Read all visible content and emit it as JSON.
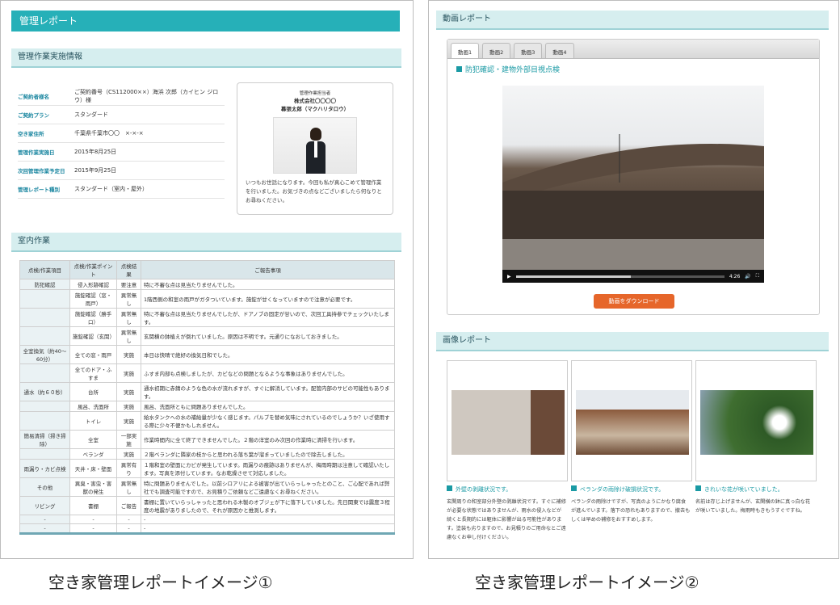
{
  "left": {
    "title": "管理レポート",
    "sec1": "管理作業実施情報",
    "info": [
      {
        "k": "ご契約者様名",
        "v": "ご契約番号（CS112000××）海浜 次郎（カイヒン ジロウ）様"
      },
      {
        "k": "ご契約プラン",
        "v": "スタンダード"
      },
      {
        "k": "空き家住所",
        "v": "千葉県千葉市〇〇　×-×-×"
      },
      {
        "k": "管理作業実施日",
        "v": "2015年8月25日"
      },
      {
        "k": "次回管理作業予定日",
        "v": "2015年9月25日"
      },
      {
        "k": "管理レポート種別",
        "v": "スタンダード（室内・屋外）"
      }
    ],
    "mgr_role": "管理作業担当者",
    "mgr_company": "株式会社〇〇〇〇",
    "mgr_name": "幕張太郎（マクハリタロウ）",
    "mgr_msg": "いつもお世話になります。今回も私が真心こめて管理作業を行いました。お気づきの点などございましたら何なりとお尋ねください。",
    "sec2": "室内作業",
    "table_head": [
      "点検/作業項目",
      "点検/作業ポイント",
      "点検結果",
      "ご報告事項"
    ],
    "rows": [
      [
        "防犯確認",
        "侵入形跡確認",
        "要注意",
        "特に不審な点は見当たりませんでした。"
      ],
      [
        "",
        "施錠確認（窓・雨戸）",
        "異常無し",
        "1階西側の和室の雨戸がガタついています。施錠が甘くなっていますので注意が必要です。"
      ],
      [
        "",
        "施錠確認（勝手口）",
        "異常無し",
        "特に不審な点は見当たりませんでしたが、ドアノブの固定が甘いので、次回工具持参でチェックいたします。"
      ],
      [
        "",
        "施錠確認（玄関）",
        "異常無し",
        "玄関横の鉢植えが倒れていました。原因は不明です。元通りになおしておきました。"
      ],
      [
        "全室換気（約40〜60分）",
        "全ての窓・雨戸",
        "実施",
        "本日は快晴で絶好の換気日和でした。"
      ],
      [
        "",
        "全てのドア・ふすま",
        "実施",
        "ふすま内部も点検しましたが、カビなどの問題となるような事象はありませんでした。"
      ],
      [
        "通水（約６０秒）",
        "台所",
        "実施",
        "通水初期に赤錆のような色の水が流れますが、すぐに解消しています。配管内部のサビの可能性もあります。"
      ],
      [
        "",
        "風呂、洗面所",
        "実施",
        "風呂、洗面所ともに問題ありませんでした。"
      ],
      [
        "",
        "トイレ",
        "実施",
        "給水タンクへの水の補給量が少なく感じます。パルブを替め気味にされているのでしょうか？いざ使用する際に少々不便かもしれません。"
      ],
      [
        "簡易清掃（掃き掃除）",
        "全室",
        "一部実施",
        "作業時間内に全て終了できませんでした。２階の洋室のみ次回の作業時に清掃を行います。"
      ],
      [
        "",
        "ベランダ",
        "実施",
        "２階ベランダに隣家の枝からと思われる落ち葉が溜まっていましたので除去しました。"
      ],
      [
        "雨漏り・カビ点検",
        "天井・床・壁面",
        "異常有り",
        "１階和室の壁面にカビが発生しています。雨漏りの痕跡はありませんが、梅雨時期は注意して確認いたします。写真を添付しています。なお乾燥させて対応しました。"
      ],
      [
        "その他",
        "異臭・害虫・害獣の発生",
        "異常無し",
        "特に問題ありませんでした。以前シロアリによる被害が出ていらっしゃったとのこと、ご心配であれば弊社でも調査可能ですので、お見積りご依頼などご遠慮なくお尋ねください。"
      ],
      [
        "リビング",
        "書棚",
        "ご報告",
        "書棚に置いていらっしゃったと思われる木製のオブジェが下に落下していました。先日関東では震度３程度の地震がありましたので、それが原因かと推測します。"
      ],
      [
        "-",
        "-",
        "-",
        "-"
      ],
      [
        "-",
        "-",
        "-",
        "-"
      ]
    ],
    "footer": "空き家管理レポートイメージ①"
  },
  "right": {
    "sec1": "動画レポート",
    "tabs": [
      "動画1",
      "動画2",
      "動画3",
      "動画4"
    ],
    "video_title": "防犯確認・建物外部目視点検",
    "time": "4:26",
    "download": "動画をダウンロード",
    "sec2": "画像レポート",
    "images": [
      {
        "cap": "外壁の剥離状況です。",
        "text": "玄関周りの和室部分外壁の剥離状況です。すぐに補修が必要な状態ではありませんが、雨水の侵入などが続くと長期的には躯体に影響が出る可能性があります。塗装も劣りますので、お見積りのご用命なとご遠慮なくお申し付けください。"
      },
      {
        "cap": "ベランダの雨除け破損状況です。",
        "text": "ベランダの雨除けですが、写真のようにかなり腐食が進んでいます。落下の恐れもありますので、撤去もしくは早めの補修をおすすめします。"
      },
      {
        "cap": "きれいな花が咲いていました。",
        "text": "名前は存じ上げませんが、玄関横の鉢に真っ白な花が咲いていました。梅雨時もきもうすぐですね。"
      }
    ],
    "footer": "空き家管理レポートイメージ②"
  }
}
